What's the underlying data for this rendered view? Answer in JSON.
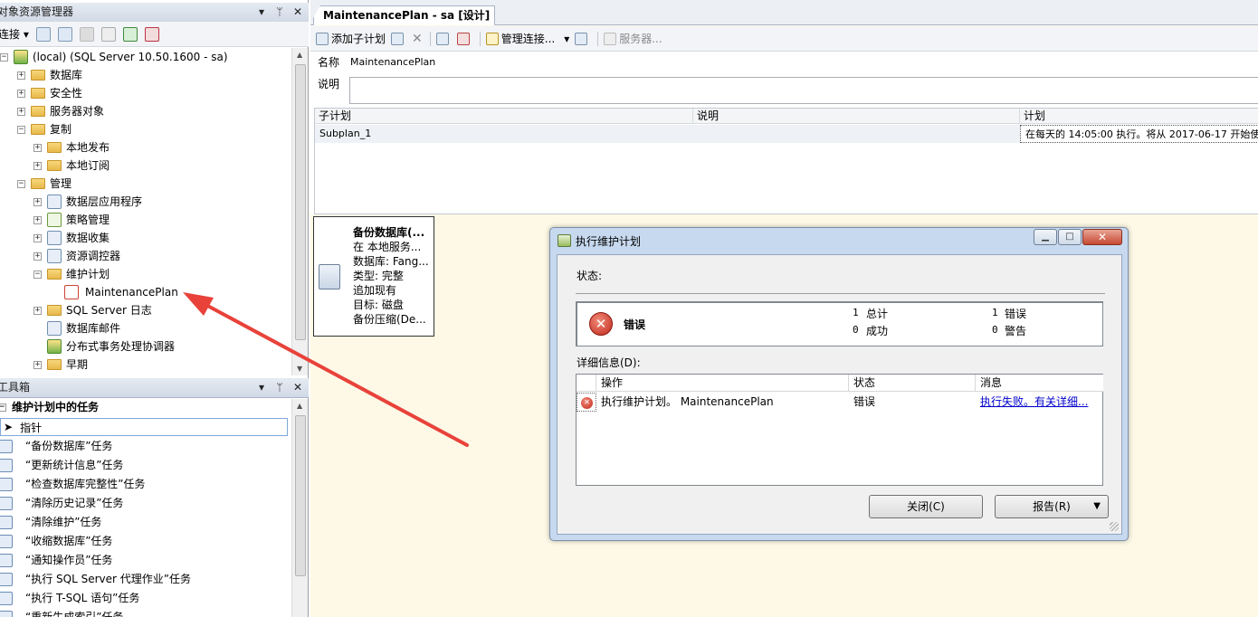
{
  "object_explorer": {
    "title": "对象资源管理器",
    "connect_label": "连接",
    "server_node": "(local) (SQL Server 10.50.1600 - sa)",
    "nodes": {
      "databases": "数据库",
      "security": "安全性",
      "server_objects": "服务器对象",
      "replication": "复制",
      "local_publications": "本地发布",
      "local_subscriptions": "本地订阅",
      "management": "管理",
      "data_tier_apps": "数据层应用程序",
      "policy_management": "策略管理",
      "data_collection": "数据收集",
      "resource_governor": "资源调控器",
      "maintenance_plans": "维护计划",
      "maintenance_plan_item": "MaintenancePlan",
      "sql_server_logs": "SQL Server 日志",
      "database_mail": "数据库邮件",
      "dtc": "分布式事务处理协调器",
      "legacy": "早期"
    }
  },
  "toolbox": {
    "title": "工具箱",
    "section": "维护计划中的任务",
    "pointer": "指针",
    "items": [
      "“备份数据库”任务",
      "“更新统计信息”任务",
      "“检查数据库完整性”任务",
      "“清除历史记录”任务",
      "“清除维护”任务",
      "“收缩数据库”任务",
      "“通知操作员”任务",
      "“执行 SQL Server 代理作业”任务",
      "“执行 T-SQL 语句”任务",
      "“重新生成索引”任务"
    ]
  },
  "document": {
    "tab_title": "MaintenancePlan - sa [设计]",
    "toolbar": {
      "add_subplan": "添加子计划",
      "manage_connections": "管理连接...",
      "servers": "服务器..."
    },
    "name_label": "名称",
    "name_value": "MaintenancePlan",
    "desc_label": "说明",
    "grid_headers": [
      "子计划",
      "说明",
      "计划"
    ],
    "grid_row": {
      "subplan": "Subplan_1",
      "description": "",
      "schedule": "在每天的 14:05:00 执行。将从 2017-06-17 开始使"
    },
    "task": {
      "lines": [
        "备份数据库(...",
        "在 本地服务...",
        "数据库: Fang...",
        "类型: 完整",
        "追加现有",
        "目标: 磁盘",
        "备份压缩(De..."
      ]
    }
  },
  "dialog": {
    "title": "执行维护计划",
    "status_label": "状态:",
    "result": "错误",
    "total_count": "1",
    "total_label": "总计",
    "success_count": "0",
    "success_label": "成功",
    "error_count": "1",
    "error_label": "错误",
    "warning_count": "0",
    "warning_label": "警告",
    "details_label": "详细信息(D):",
    "columns": [
      "操作",
      "状态",
      "消息"
    ],
    "row": {
      "action": "执行维护计划。 MaintenancePlan",
      "status": "错误",
      "message": "执行失败。有关详细..."
    },
    "close_button": "关闭(C)",
    "report_button": "报告(R)"
  },
  "colors": {
    "arrow": "#e8423a",
    "designer_bg": "#fdf9e6",
    "dialog_frame": "#c7d9ef"
  }
}
